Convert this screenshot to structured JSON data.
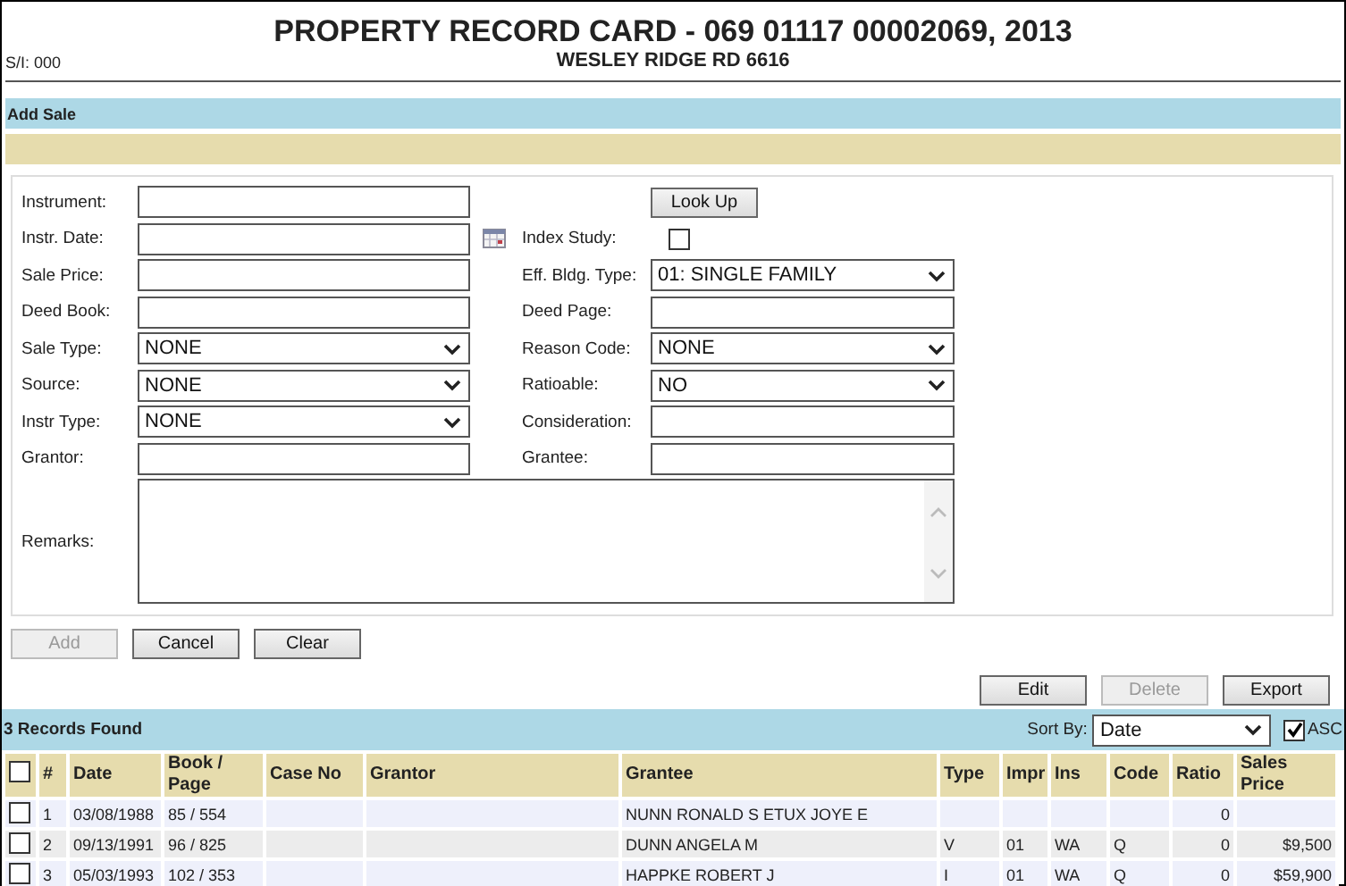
{
  "header": {
    "title": "PROPERTY RECORD CARD - 069 01117 00002069, 2013",
    "subtitle": "WESLEY RIDGE RD 6616",
    "serial": "S/I: 000"
  },
  "add_sale": {
    "title": "Add Sale"
  },
  "form": {
    "rows": [
      {
        "left": {
          "label": "Instrument:",
          "kind": "text"
        },
        "right": {
          "kind": "button",
          "label": "Look Up"
        }
      },
      {
        "left": {
          "label": "Instr. Date:",
          "kind": "date"
        },
        "right": {
          "label": "Index Study:",
          "kind": "checkbox",
          "checked": false
        }
      },
      {
        "left": {
          "label": "Sale Price:",
          "kind": "text"
        },
        "right": {
          "label": "Eff. Bldg. Type:",
          "kind": "select",
          "value": "01: SINGLE FAMILY"
        }
      },
      {
        "left": {
          "label": "Deed Book:",
          "kind": "text"
        },
        "right": {
          "label": "Deed Page:",
          "kind": "text"
        }
      },
      {
        "left": {
          "label": "Sale Type:",
          "kind": "select",
          "value": "NONE"
        },
        "right": {
          "label": "Reason Code:",
          "kind": "select",
          "value": "NONE"
        }
      },
      {
        "left": {
          "label": "Source:",
          "kind": "select",
          "value": "NONE"
        },
        "right": {
          "label": "Ratioable:",
          "kind": "select",
          "value": "NO"
        }
      },
      {
        "left": {
          "label": "Instr Type:",
          "kind": "select",
          "value": "NONE"
        },
        "right": {
          "label": "Consideration:",
          "kind": "text"
        }
      },
      {
        "left": {
          "label": "Grantor:",
          "kind": "text"
        },
        "right": {
          "label": "Grantee:",
          "kind": "text"
        }
      }
    ],
    "remarks": {
      "label": "Remarks:"
    }
  },
  "form_buttons": [
    {
      "label": "Add",
      "disabled": true
    },
    {
      "label": "Cancel",
      "disabled": false
    },
    {
      "label": "Clear",
      "disabled": false
    }
  ],
  "record_buttons": [
    {
      "label": "Edit",
      "disabled": false
    },
    {
      "label": "Delete",
      "disabled": true
    },
    {
      "label": "Export",
      "disabled": false
    }
  ],
  "results": {
    "title": "3 Records Found",
    "sort_label": "Sort By:",
    "sort_value": "Date",
    "asc": {
      "label": "ASC",
      "checked": true
    }
  },
  "table": {
    "all_selected": false,
    "columns": [
      "#",
      "Date",
      "Book / Page",
      "Case No",
      "Grantor",
      "Grantee",
      "Type",
      "Impr",
      "Ins",
      "Code",
      "Ratio",
      "Sales Price"
    ],
    "rows": [
      {
        "selected": false,
        "cells": [
          "1",
          "03/08/1988",
          "85 / 554",
          "",
          "",
          "NUNN RONALD S ETUX JOYE E",
          "",
          "",
          "",
          "",
          "0",
          ""
        ]
      },
      {
        "selected": false,
        "cells": [
          "2",
          "09/13/1991",
          "96 / 825",
          "",
          "",
          "DUNN ANGELA M",
          "V",
          "01",
          "WA",
          "Q",
          "0",
          "$9,500"
        ]
      },
      {
        "selected": false,
        "cells": [
          "3",
          "05/03/1993",
          "102 / 353",
          "",
          "",
          "HAPPKE ROBERT J",
          "I",
          "01",
          "WA",
          "Q",
          "0",
          "$59,900"
        ]
      }
    ]
  }
}
